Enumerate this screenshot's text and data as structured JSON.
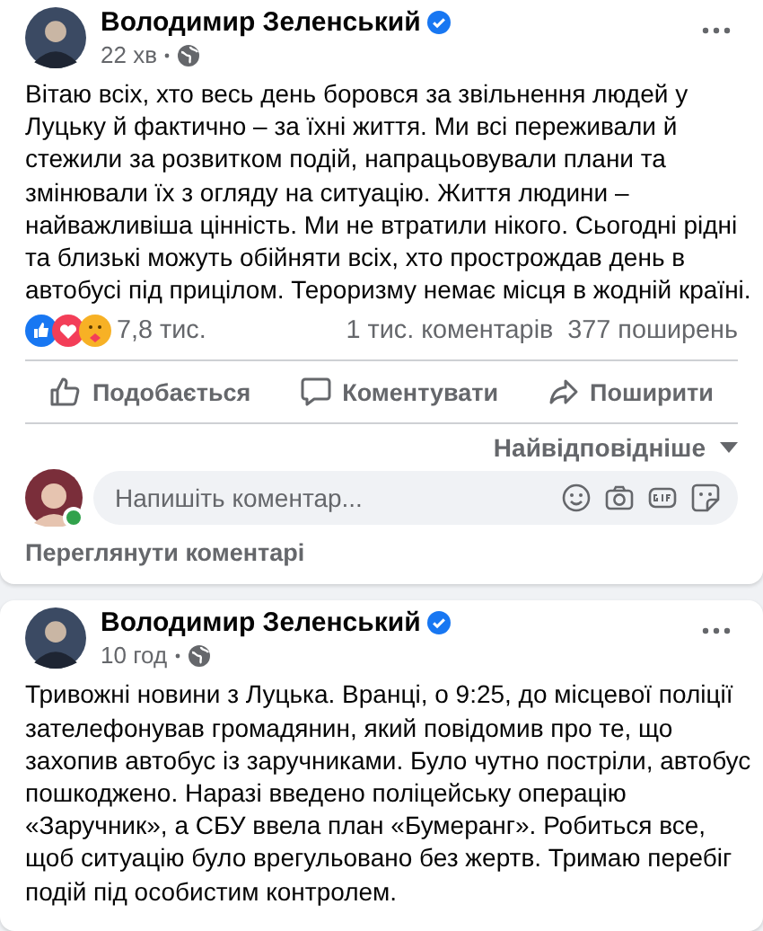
{
  "posts": [
    {
      "author": "Володимир Зеленський",
      "verified": true,
      "time": "22 хв",
      "text": "Вітаю всіх, хто весь день боровся за звільнення людей у Луцьку й фактично – за їхні життя. Ми всі переживали й стежили за розвитком подій, напрацьовували плани та змінювали їх з огляду на ситуацію. Життя людини – найважливіша цінність. Ми не втратили нікого. Сьогодні рідні та близькі можуть обійняти всіх, хто прострождав день в автобусі під прицілом. Тероризму немає місця в жодній країні.",
      "reactions_count": "7,8 тис.",
      "comments_count": "1 тис. коментарів",
      "shares_count": "377 поширень",
      "actions": [
        "Подобається",
        "Коментувати",
        "Поширити"
      ],
      "sort": "Найвідповідніше",
      "composer": {
        "placeholder": "Напишіть коментар...",
        "online": true
      },
      "view_comments": "Переглянути коментарі"
    },
    {
      "author": "Володимир Зеленський",
      "verified": true,
      "time": "10 год",
      "text": "Тривожні новини з Луцька. Вранці, о 9:25, до місцевої поліції зателефонував громадянин, який повідомив про те, що захопив автобус із заручниками. Було чутно постріли, автобус пошкоджено. Наразі введено поліцейську операцію «Заручник», а СБУ ввела план «Бумеранг». Робиться все, щоб ситуацію було врегульовано без жертв. Тримаю перебіг подій під особистим контролем."
    }
  ]
}
